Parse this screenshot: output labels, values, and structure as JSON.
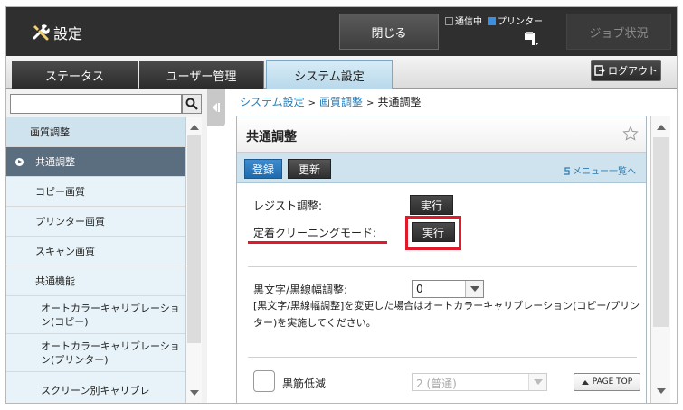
{
  "header": {
    "title": "設定",
    "close_label": "閉じる",
    "status_comm": "通信中",
    "status_printer": "プリンター",
    "job_status_label": "ジョブ状況"
  },
  "tabs": [
    {
      "label": "ステータス"
    },
    {
      "label": "ユーザー管理"
    },
    {
      "label": "システム設定"
    }
  ],
  "logout_label": "ログアウト",
  "sidebar": {
    "search_placeholder": "",
    "items": [
      {
        "label": "画質調整",
        "level": 1
      },
      {
        "label": "共通調整",
        "level": 2,
        "selected": true
      },
      {
        "label": "コピー画質",
        "level": 2
      },
      {
        "label": "プリンター画質",
        "level": 2
      },
      {
        "label": "スキャン画質",
        "level": 2
      },
      {
        "label": "共通機能",
        "level": 2
      },
      {
        "label": "オートカラーキャリブレーション(コピー)",
        "level": 3
      },
      {
        "label": "オートカラーキャリブレーション(プリンター)",
        "level": 3
      },
      {
        "label": "スクリーン別キャリブレ",
        "level": 3
      }
    ]
  },
  "breadcrumb": {
    "part1": "システム設定",
    "part2": "画質調整",
    "current": "共通調整",
    "separator": ">"
  },
  "panel": {
    "title": "共通調整",
    "register_label": "登録",
    "update_label": "更新",
    "menu_link": "メニュー一覧へ",
    "regist_label": "レジスト調整:",
    "exec_label": "実行",
    "cleaning_label": "定着クリーニングモード:",
    "black_text_label": "黒文字/黒線幅調整:",
    "black_text_value": "0",
    "note": "[黒文字/黒線幅調整]を変更した場合はオートカラーキャリブレーション(コピー/プリンター)を実施してください。",
    "streak_label": "黒筋低減",
    "streak_value": "2 (普通)",
    "page_top_label": "PAGE TOP"
  },
  "colors": {
    "accent_blue": "#1f6aab",
    "highlight_red": "#e01a2a",
    "sidebar_selected": "#5b6e80"
  }
}
